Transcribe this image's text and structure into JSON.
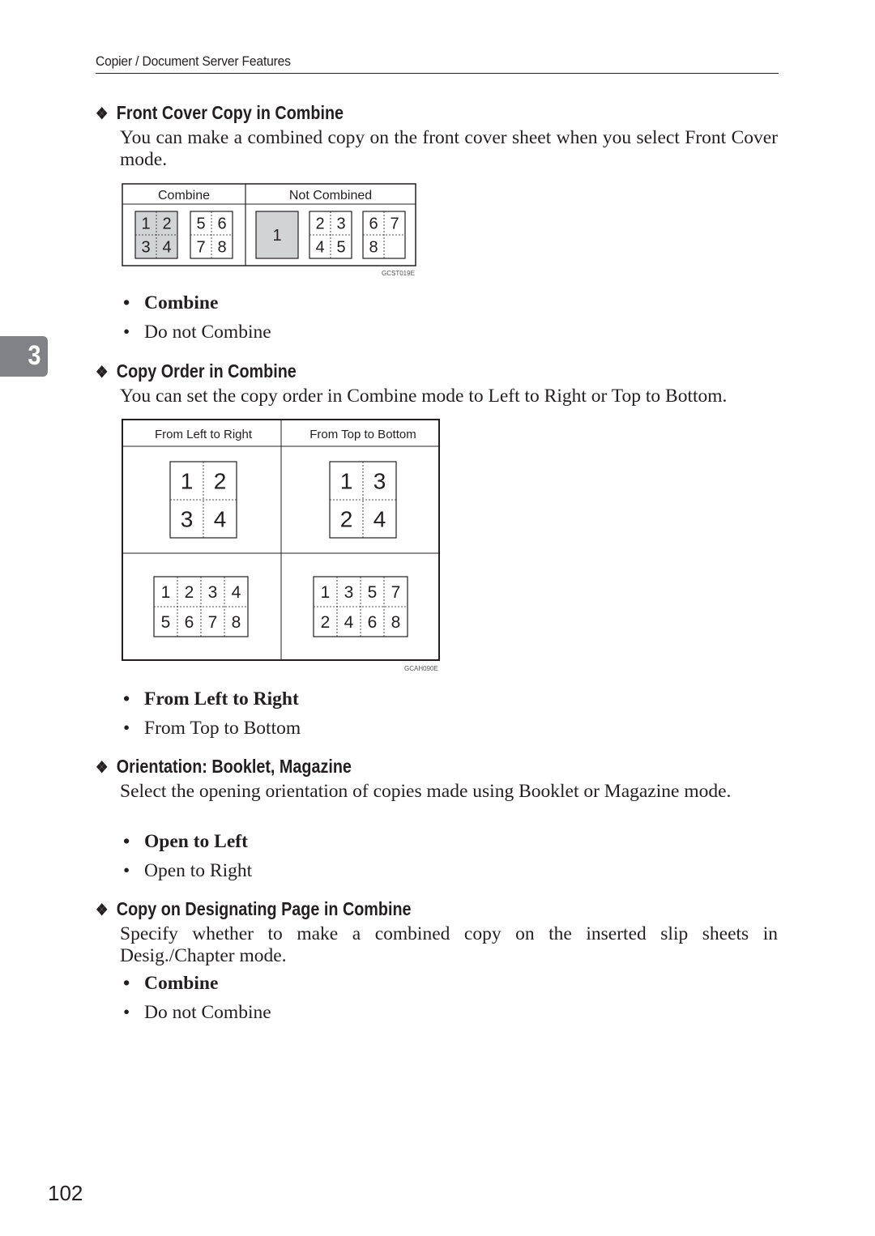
{
  "header": {
    "title": "Copier / Document Server Features"
  },
  "chapter_tab": {
    "number": "3"
  },
  "sections": [
    {
      "heading": "Front Cover Copy in Combine",
      "body": "You can make a combined copy on the front cover sheet when you select Front Cover mode.",
      "figure": {
        "code": "GCST019E",
        "columns": [
          {
            "label": "Combine",
            "sheets": [
              {
                "cells": [
                  [
                    "1",
                    "2"
                  ],
                  [
                    "3",
                    "4"
                  ]
                ],
                "shaded": true
              },
              {
                "cells": [
                  [
                    "5",
                    "6"
                  ],
                  [
                    "7",
                    "8"
                  ]
                ],
                "shaded": false
              }
            ]
          },
          {
            "label": "Not Combined",
            "sheets": [
              {
                "cells": [
                  [
                    "1"
                  ]
                ],
                "shaded": true
              },
              {
                "cells": [
                  [
                    "2",
                    "3"
                  ],
                  [
                    "4",
                    "5"
                  ]
                ],
                "shaded": false
              },
              {
                "cells": [
                  [
                    "6",
                    "7"
                  ],
                  [
                    "8",
                    ""
                  ]
                ],
                "shaded": false
              }
            ]
          }
        ]
      },
      "options": [
        {
          "label": "Combine",
          "default": true
        },
        {
          "label": "Do not Combine",
          "default": false
        }
      ]
    },
    {
      "heading": "Copy Order in Combine",
      "body": "You can set the copy order in Combine mode to Left to Right or Top to Bottom.",
      "figure": {
        "code": "GCAH090E",
        "columns": [
          {
            "label": "From Left to Right",
            "grids": [
              [
                [
                  "1",
                  "2"
                ],
                [
                  "3",
                  "4"
                ]
              ],
              [
                [
                  "1",
                  "2",
                  "3",
                  "4"
                ],
                [
                  "5",
                  "6",
                  "7",
                  "8"
                ]
              ]
            ]
          },
          {
            "label": "From Top to Bottom",
            "grids": [
              [
                [
                  "1",
                  "3"
                ],
                [
                  "2",
                  "4"
                ]
              ],
              [
                [
                  "1",
                  "3",
                  "5",
                  "7"
                ],
                [
                  "2",
                  "4",
                  "6",
                  "8"
                ]
              ]
            ]
          }
        ]
      },
      "options": [
        {
          "label": "From Left to Right",
          "default": true
        },
        {
          "label": "From Top to Bottom",
          "default": false
        }
      ]
    },
    {
      "heading": "Orientation: Booklet, Magazine",
      "body": "Select the opening orientation of copies made using Booklet or Magazine mode.",
      "options": [
        {
          "label": "Open to Left",
          "default": true
        },
        {
          "label": "Open to Right",
          "default": false
        }
      ]
    },
    {
      "heading": "Copy on Designating Page in Combine",
      "body": "Specify whether to make a combined copy on the inserted slip sheets in Desig./Chapter mode.",
      "options": [
        {
          "label": "Combine",
          "default": true
        },
        {
          "label": "Do not Combine",
          "default": false
        }
      ]
    }
  ],
  "page_number": "102",
  "colors": {
    "text": "#231f20",
    "tab": "#808285",
    "shade": "#d1d3d4"
  }
}
